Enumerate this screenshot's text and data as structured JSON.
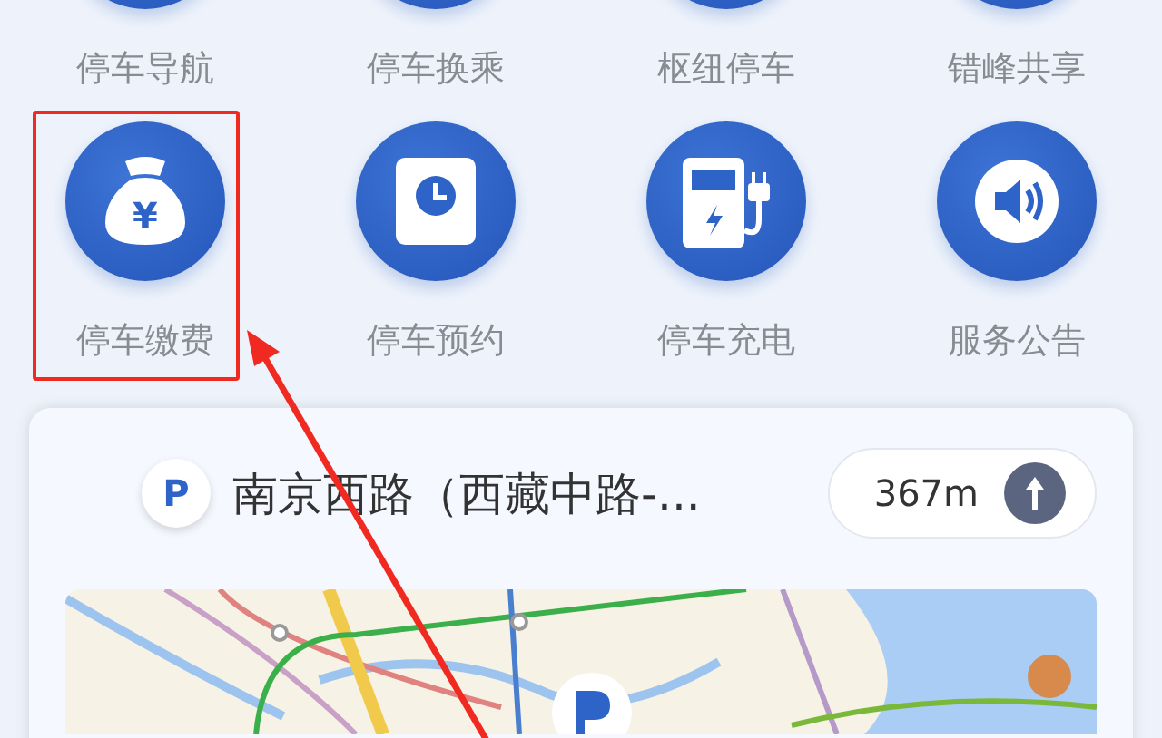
{
  "services": [
    {
      "label": "停车导航",
      "kind": "plain",
      "highlighted": false
    },
    {
      "label": "停车换乘",
      "kind": "plain",
      "highlighted": false
    },
    {
      "label": "枢纽停车",
      "kind": "plain",
      "highlighted": false
    },
    {
      "label": "错峰共享",
      "kind": "plain",
      "highlighted": false
    },
    {
      "label": "停车缴费",
      "kind": "money",
      "icon_text": "¥",
      "highlighted": true
    },
    {
      "label": "停车预约",
      "kind": "clock",
      "highlighted": false
    },
    {
      "label": "停车充电",
      "kind": "charger",
      "highlighted": false
    },
    {
      "label": "服务公告",
      "kind": "speaker",
      "highlighted": false
    }
  ],
  "parking_card": {
    "badge": "P",
    "title": "南京西路（西藏中路-...",
    "distance": "367m"
  }
}
